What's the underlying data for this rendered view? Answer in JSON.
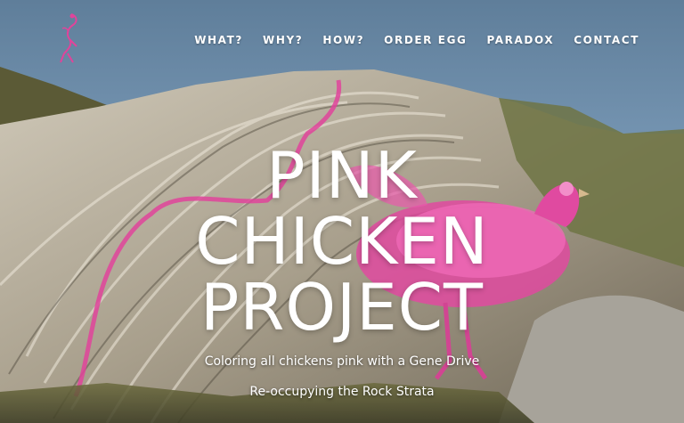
{
  "nav": {
    "items": [
      "WHAT?",
      "WHY?",
      "HOW?",
      "ORDER EGG",
      "PARADOX",
      "CONTACT"
    ]
  },
  "hero": {
    "title_lines": [
      "PINK",
      "CHICKEN",
      "PROJECT"
    ],
    "subtitle": "Coloring all chickens pink with a Gene Drive",
    "tagline": "Re-occupying the Rock Strata"
  },
  "colors": {
    "sky": "#8fb3d2",
    "rock": "#b9b2a3",
    "pink": "#e0449b"
  },
  "icons": {
    "logo": "pink-flamingo-chicken-logo"
  }
}
